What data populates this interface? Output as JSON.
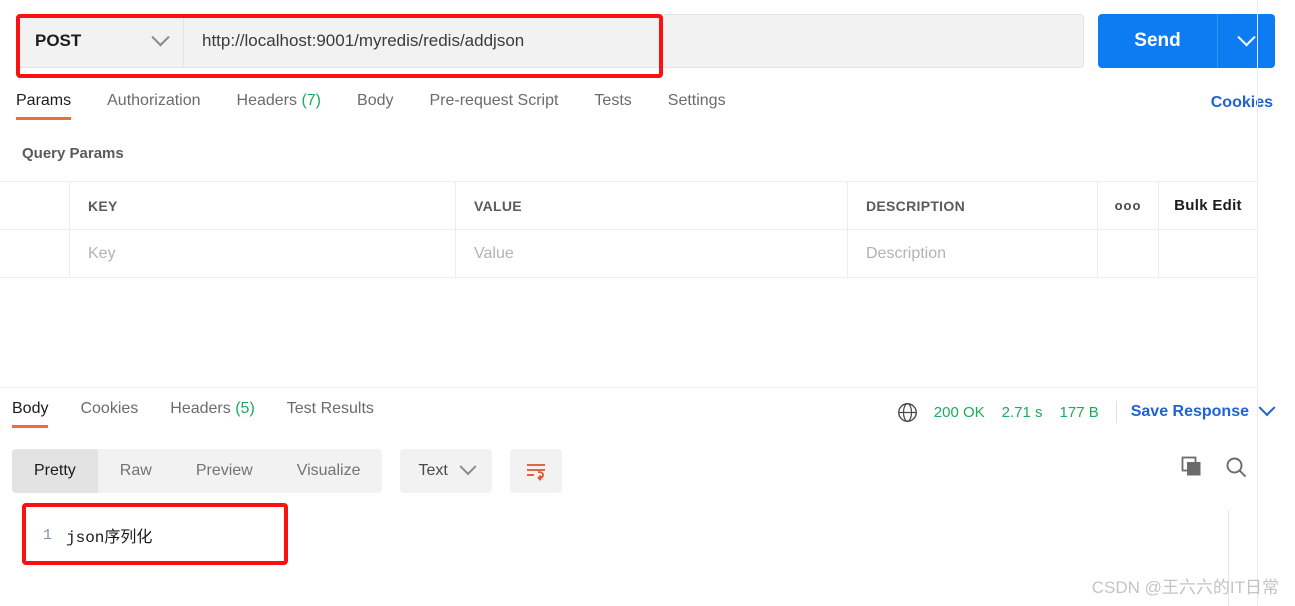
{
  "request": {
    "method": "POST",
    "url": "http://localhost:9001/myredis/redis/addjson",
    "send_label": "Send",
    "tabs": [
      {
        "label": "Params",
        "count": ""
      },
      {
        "label": "Authorization",
        "count": ""
      },
      {
        "label": "Headers",
        "count": "(7)"
      },
      {
        "label": "Body",
        "count": ""
      },
      {
        "label": "Pre-request Script",
        "count": ""
      },
      {
        "label": "Tests",
        "count": ""
      },
      {
        "label": "Settings",
        "count": ""
      }
    ],
    "cookies_link": "Cookies",
    "query_params_label": "Query Params",
    "table": {
      "headers": [
        "KEY",
        "VALUE",
        "DESCRIPTION"
      ],
      "dots_label": "ooo",
      "bulk_edit_label": "Bulk Edit",
      "placeholder_row": [
        "Key",
        "Value",
        "Description"
      ]
    }
  },
  "response": {
    "tabs": [
      {
        "label": "Body",
        "count": ""
      },
      {
        "label": "Cookies",
        "count": ""
      },
      {
        "label": "Headers",
        "count": "(5)"
      },
      {
        "label": "Test Results",
        "count": ""
      }
    ],
    "status": "200 OK",
    "time": "2.71 s",
    "size": "177 B",
    "save_label": "Save Response",
    "view_modes": [
      "Pretty",
      "Raw",
      "Preview",
      "Visualize"
    ],
    "format": "Text",
    "body_lines": [
      {
        "num": "1",
        "text": "json序列化"
      }
    ]
  },
  "watermark": "CSDN @王六六的IT日常",
  "colors": {
    "accent_blue": "#0d7cf2",
    "link_blue": "#1f62d4",
    "tab_underline": "#f26b3a",
    "status_green": "#1bab5c",
    "annotation_red": "#fb1111"
  }
}
